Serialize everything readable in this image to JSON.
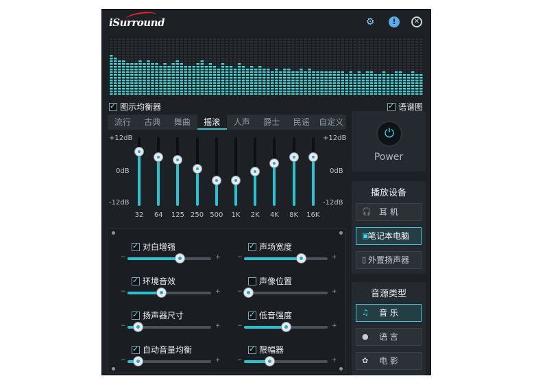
{
  "app": {
    "logo": "iSurround"
  },
  "titlebar": {
    "settings_icon": "gear-icon",
    "info_icon": "info-icon",
    "close_icon": "close-icon"
  },
  "spectrum": {
    "levels": [
      0.72,
      0.68,
      0.62,
      0.64,
      0.58,
      0.56,
      0.55,
      0.6,
      0.57,
      0.62,
      0.55,
      0.58,
      0.52,
      0.57,
      0.53,
      0.56,
      0.6,
      0.55,
      0.53,
      0.52,
      0.5,
      0.57,
      0.6,
      0.52,
      0.56,
      0.53,
      0.48,
      0.56,
      0.5,
      0.51,
      0.48,
      0.55,
      0.5,
      0.46,
      0.5,
      0.47,
      0.53,
      0.47,
      0.47,
      0.45,
      0.48,
      0.44,
      0.49,
      0.46,
      0.45,
      0.43,
      0.47,
      0.42,
      0.46,
      0.45,
      0.44,
      0.45,
      0.45,
      0.42,
      0.43,
      0.43,
      0.42,
      0.4,
      0.41,
      0.4,
      0.41,
      0.4,
      0.42,
      0.41,
      0.4,
      0.39,
      0.41,
      0.4,
      0.4,
      0.41,
      0.41,
      0.39,
      0.4,
      0.41,
      0.39,
      0.4
    ]
  },
  "toggles": {
    "equalizer": {
      "label": "图示均衡器",
      "checked": true
    },
    "spectrum": {
      "label": "语谱图",
      "checked": true
    }
  },
  "presets": [
    "流行",
    "古典",
    "舞曲",
    "摇滚",
    "人声",
    "爵士",
    "民谣",
    "自定义"
  ],
  "active_preset": "摇滚",
  "eq": {
    "db_top": "+12dB",
    "db_mid": "0dB",
    "db_bottom": "-12dB",
    "bands": [
      {
        "freq": "32",
        "gain": 7
      },
      {
        "freq": "64",
        "gain": 5
      },
      {
        "freq": "125",
        "gain": 4
      },
      {
        "freq": "250",
        "gain": 1
      },
      {
        "freq": "500",
        "gain": -3
      },
      {
        "freq": "1K",
        "gain": -3
      },
      {
        "freq": "2K",
        "gain": 0
      },
      {
        "freq": "4K",
        "gain": 3
      },
      {
        "freq": "8K",
        "gain": 5
      },
      {
        "freq": "16K",
        "gain": 5
      }
    ]
  },
  "effects": [
    {
      "label": "对白增强",
      "checked": true,
      "value": 0.62
    },
    {
      "label": "声场宽度",
      "checked": true,
      "value": 0.68
    },
    {
      "label": "环境音效",
      "checked": true,
      "value": 0.4
    },
    {
      "label": "声像位置",
      "checked": false,
      "value": 0.05
    },
    {
      "label": "扬声器尺寸",
      "checked": true,
      "value": 0.12
    },
    {
      "label": "低音强度",
      "checked": true,
      "value": 0.5
    },
    {
      "label": "自动音量均衡",
      "checked": true,
      "value": 0.12
    },
    {
      "label": "限幅器",
      "checked": true,
      "value": 0.3
    }
  ],
  "slider_minus": "−",
  "slider_plus": "+",
  "power": {
    "label": "Power"
  },
  "playback": {
    "title": "播放设备",
    "items": [
      {
        "label": "耳 机",
        "icon": "headphones-icon",
        "active": false
      },
      {
        "label": "笔记本电脑",
        "icon": "laptop-icon",
        "active": true
      },
      {
        "label": "外置扬声器",
        "icon": "speaker-icon",
        "active": false
      }
    ]
  },
  "source": {
    "title": "音源类型",
    "items": [
      {
        "label": "音 乐",
        "icon": "music-note-icon",
        "active": true
      },
      {
        "label": "语 言",
        "icon": "speech-bubble-icon",
        "active": false
      },
      {
        "label": "电 影",
        "icon": "film-reel-icon",
        "active": false
      }
    ]
  },
  "colors": {
    "accent": "#28c3d0",
    "background": "#1d2126",
    "spectrum_bar": "#46d3d3"
  }
}
